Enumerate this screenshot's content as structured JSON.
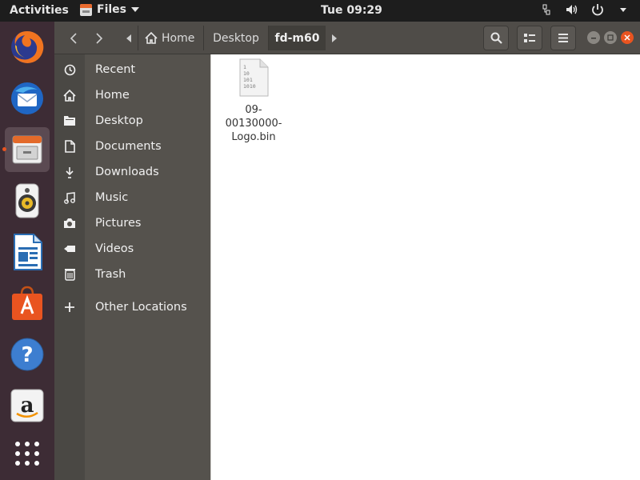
{
  "topbar": {
    "activities": "Activities",
    "app_name": "Files",
    "clock": "Tue 09:29"
  },
  "dock": {
    "items": [
      {
        "name": "firefox"
      },
      {
        "name": "thunderbird"
      },
      {
        "name": "files"
      },
      {
        "name": "rhythmbox"
      },
      {
        "name": "libreoffice-writer"
      },
      {
        "name": "ubuntu-software"
      },
      {
        "name": "help"
      },
      {
        "name": "amazon"
      },
      {
        "name": "show-applications"
      }
    ]
  },
  "pathbar": {
    "crumbs": [
      "Home",
      "Desktop",
      "fd-m60"
    ]
  },
  "sidebar": {
    "items": [
      {
        "label": "Recent",
        "icon": "clock-icon"
      },
      {
        "label": "Home",
        "icon": "home-icon"
      },
      {
        "label": "Desktop",
        "icon": "folder-icon"
      },
      {
        "label": "Documents",
        "icon": "document-icon"
      },
      {
        "label": "Downloads",
        "icon": "download-icon"
      },
      {
        "label": "Music",
        "icon": "music-icon"
      },
      {
        "label": "Pictures",
        "icon": "camera-icon"
      },
      {
        "label": "Videos",
        "icon": "video-icon"
      },
      {
        "label": "Trash",
        "icon": "trash-icon"
      }
    ],
    "other_locations": "Other Locations"
  },
  "files": [
    {
      "name": "09-00130000-Logo.bin",
      "display_lines": [
        "09-",
        "00130000-",
        "Logo.bin"
      ],
      "icon_text": [
        "1",
        "10",
        "101",
        "1010"
      ]
    }
  ],
  "colors": {
    "accent": "#e95420",
    "dock_bg": "#3d2c35",
    "sidebar_bg": "#55524d",
    "headerbar_bg": "#4f4c48"
  }
}
